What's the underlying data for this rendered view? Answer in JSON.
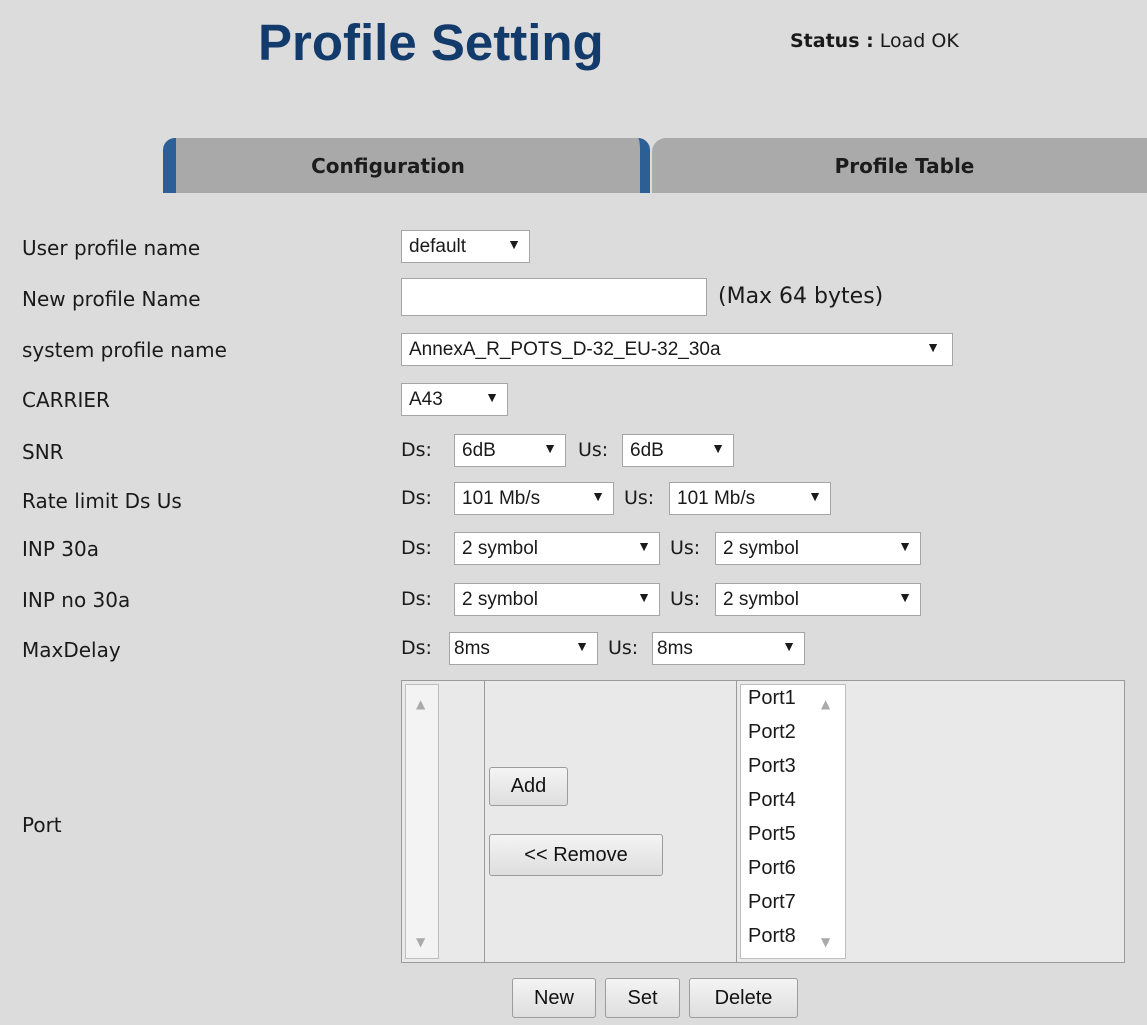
{
  "header": {
    "title": "Profile Setting",
    "status_key": "Status :",
    "status_value": "Load OK"
  },
  "tabs": {
    "configuration": "Configuration",
    "profile_table": "Profile Table"
  },
  "labels": {
    "user_profile": "User profile name",
    "new_profile": "New profile Name",
    "system_profile": "system profile name",
    "carrier": "CARRIER",
    "snr": "SNR",
    "rate_limit": "Rate limit Ds Us",
    "inp_30a": "INP 30a",
    "inp_no_30a": "INP no 30a",
    "max_delay": "MaxDelay",
    "port": "Port"
  },
  "common": {
    "ds": "Ds:",
    "us": "Us:",
    "arrow": "▼"
  },
  "fields": {
    "user_profile": "default",
    "new_profile_hint": "(Max 64 bytes)",
    "new_profile_value": "",
    "system_profile": "AnnexA_R_POTS_D-32_EU-32_30a",
    "carrier": "A43",
    "snr_ds": "6dB",
    "snr_us": "6dB",
    "rate_ds": "101 Mb/s",
    "rate_us": "101 Mb/s",
    "inp30a_ds": "2 symbol",
    "inp30a_us": "2 symbol",
    "inpno30a_ds": "2 symbol",
    "inpno30a_us": "2 symbol",
    "delay_ds": "8ms",
    "delay_us": "8ms"
  },
  "ports": [
    "Port1",
    "Port2",
    "Port3",
    "Port4",
    "Port5",
    "Port6",
    "Port7",
    "Port8"
  ],
  "buttons": {
    "add": "Add",
    "remove": "<< Remove",
    "new": "New",
    "set": "Set",
    "delete": "Delete"
  },
  "icons": {
    "up": "▲",
    "down": "▼"
  }
}
